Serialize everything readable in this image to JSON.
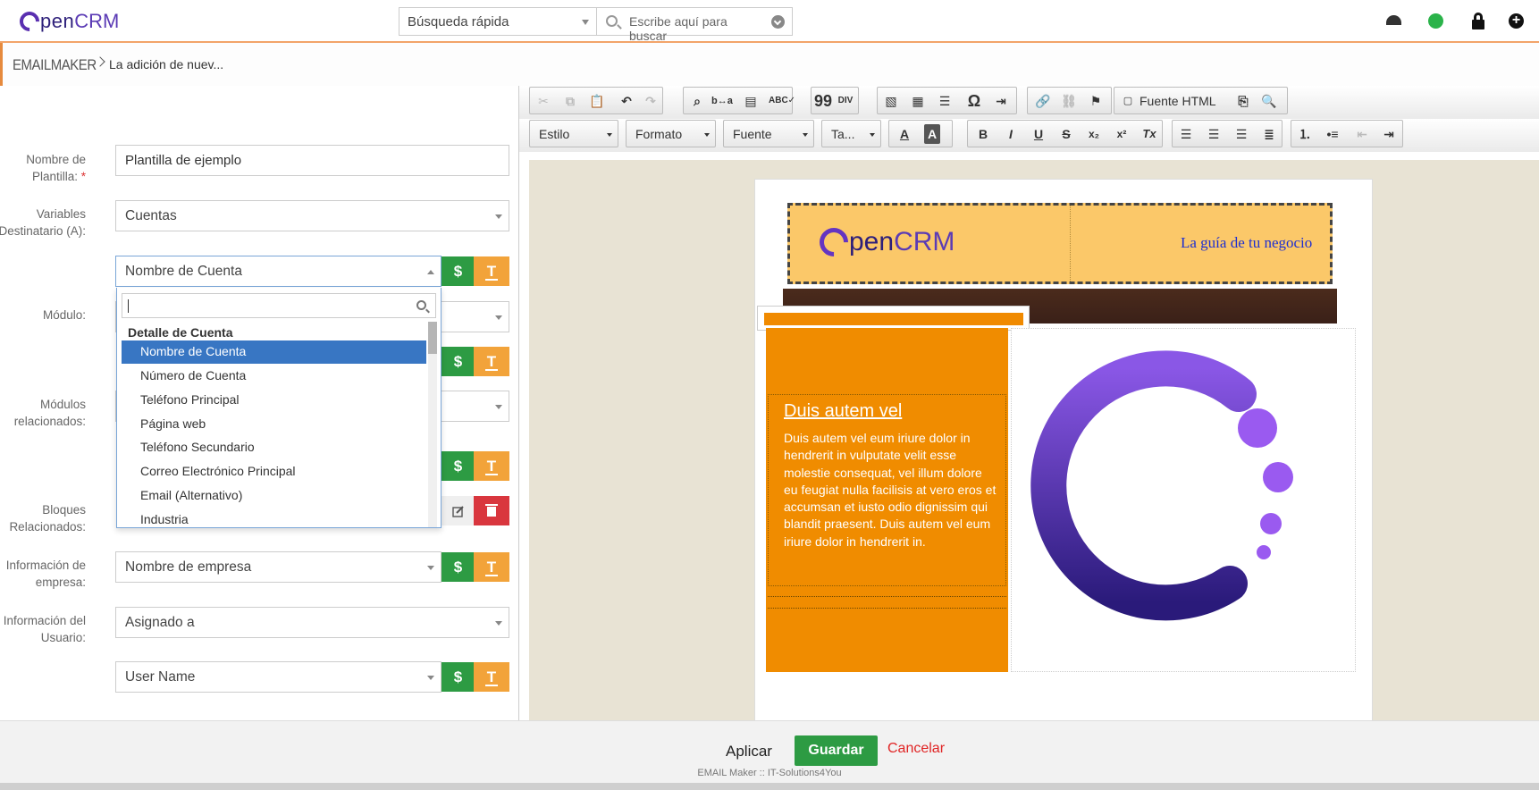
{
  "app": {
    "logo_prefix": "pen",
    "logo_suffix": "CRM"
  },
  "search": {
    "scope": "Búsqueda rápida",
    "placeholder": "Escribe aquí para buscar"
  },
  "breadcrumb": {
    "module": "EMAILMAKER",
    "page": "La adición de nuev..."
  },
  "form": {
    "template_name_label": "Nombre de Plantilla:",
    "template_name_label_l1": "Nombre de",
    "template_name_label_l2": "Plantilla:",
    "required_mark": "*",
    "template_name_value": "Plantilla de ejemplo",
    "recipient_vars_label_l1": "Variables",
    "recipient_vars_label_l2": "Destinatario (A):",
    "recipient_vars_value": "Cuentas",
    "field_select_value": "Nombre de Cuenta",
    "module_label": "Módulo:",
    "related_modules_label_l1": "Módulos",
    "related_modules_label_l2": "relacionados:",
    "related_blocks_label_l1": "Bloques",
    "related_blocks_label_l2": "Relacionados:",
    "company_info_label_l1": "Información de",
    "company_info_label_l2": "empresa:",
    "company_info_value": "Nombre de empresa",
    "user_info_label_l1": "Información del",
    "user_info_label_l2": "Usuario:",
    "user_info_value": "Asignado a",
    "user_field_value": "User Name",
    "dollar_label": "$",
    "text_label": "T"
  },
  "dropdown": {
    "group": "Detalle de Cuenta",
    "items": [
      "Nombre de Cuenta",
      "Número de Cuenta",
      "Teléfono Principal",
      "Página web",
      "Teléfono Secundario",
      "Correo Electrónico Principal",
      "Email (Alternativo)",
      "Industria"
    ],
    "selected_index": 0
  },
  "editor": {
    "source_button": "Fuente HTML",
    "combos": {
      "style": "Estilo",
      "format": "Formato",
      "font": "Fuente",
      "size": "Ta..."
    },
    "buttons": {
      "bold": "B",
      "italic": "I",
      "underline": "U",
      "strike": "S",
      "subscript": "x₂",
      "superscript": "x²",
      "clear": "Tx",
      "quote": "99",
      "omega": "Ω",
      "font_color": "A",
      "bg_color": "A"
    }
  },
  "email": {
    "logo_prefix": "pen",
    "logo_suffix": "CRM",
    "tagline": "La guía de tu negocio",
    "heading": "Duis autem vel",
    "body": "Duis autem vel eum iriure dolor in hendrerit in vulputate velit esse molestie consequat, vel illum dolore eu feugiat nulla facilisis at vero eros et accumsan et iusto odio dignissim qui blandit praesent. Duis autem vel eum iriure dolor in hendrerit in."
  },
  "footer": {
    "apply": "Aplicar",
    "save": "Guardar",
    "cancel": "Cancelar",
    "credit": "EMAIL Maker :: IT-Solutions4You"
  },
  "colors": {
    "accent_orange": "#f08c00",
    "save_green": "#2d9b43",
    "header_band": "#fbc869",
    "brand_purple": "#5b3bb5",
    "selection_blue": "#3876c3"
  }
}
